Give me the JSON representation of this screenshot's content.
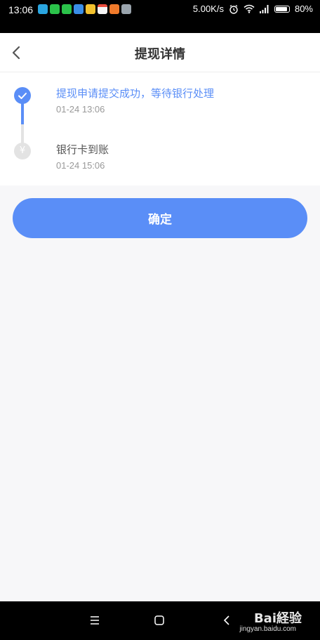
{
  "status_bar": {
    "time": "13:06",
    "network_speed": "5.00K/s",
    "battery": "80%",
    "notification_icons": [
      "app-icon",
      "wechat-icon",
      "wechat-icon",
      "qq-icon",
      "chat-icon",
      "calendar-icon",
      "mail-icon",
      "notes-icon"
    ]
  },
  "header": {
    "title": "提现详情"
  },
  "progress": {
    "steps": [
      {
        "title": "提现申请提交成功，等待银行处理",
        "time": "01-24 13:06",
        "status": "done"
      },
      {
        "title": "银行卡到账",
        "time": "01-24 15:06",
        "status": "pending",
        "icon_glyph": "¥"
      }
    ]
  },
  "confirm_button": {
    "label": "确定"
  },
  "watermark": {
    "logo": "Bai経验",
    "url": "jingyan.baidu.com"
  },
  "colors": {
    "accent": "#5a8ef7",
    "inactive": "#e3e3e3",
    "background": "#f7f7f9"
  }
}
